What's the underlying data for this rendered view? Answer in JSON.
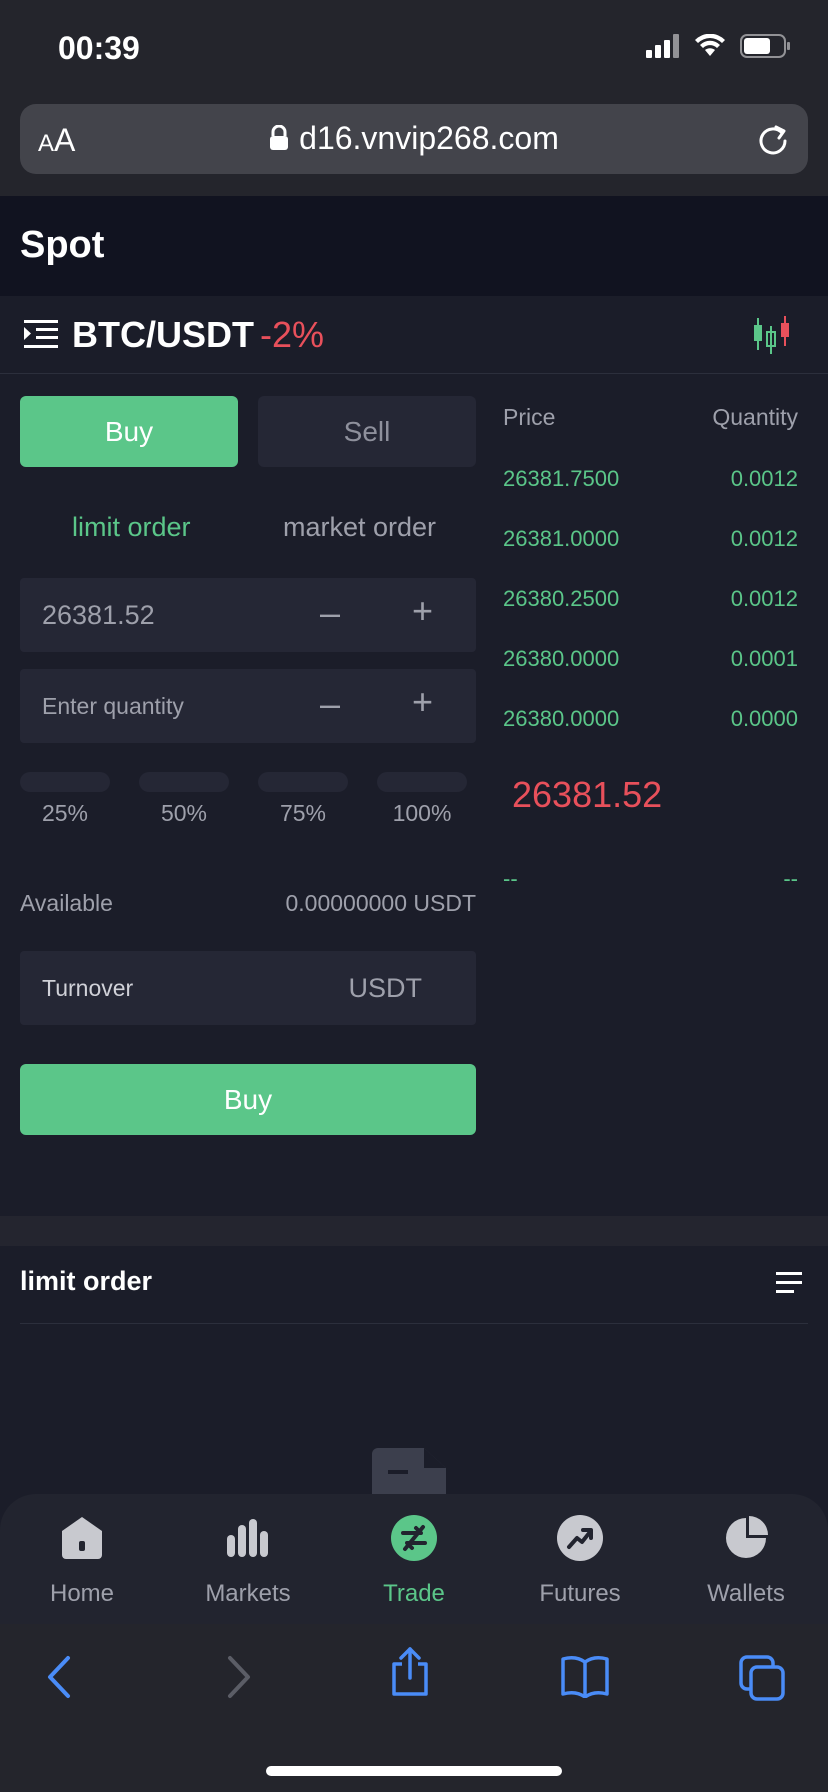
{
  "status_bar": {
    "time": "00:39"
  },
  "browser": {
    "text_size_label_small": "A",
    "text_size_label_large": "A",
    "url": "d16.vnvip268.com"
  },
  "page": {
    "title": "Spot"
  },
  "pair": {
    "name": "BTC/USDT",
    "change": "-2%"
  },
  "trade_form": {
    "tab_buy": "Buy",
    "tab_sell": "Sell",
    "order_type_limit": "limit order",
    "order_type_market": "market order",
    "price_value": "26381.52",
    "quantity_placeholder": "Enter quantity",
    "minus": "–",
    "plus": "+",
    "percents": [
      "25%",
      "50%",
      "75%",
      "100%"
    ],
    "available_label": "Available",
    "available_value": "0.00000000 USDT",
    "turnover_label": "Turnover",
    "turnover_unit": "USDT",
    "submit_label": "Buy"
  },
  "order_book": {
    "price_header": "Price",
    "quantity_header": "Quantity",
    "rows": [
      {
        "price": "26381.7500",
        "quantity": "0.0012"
      },
      {
        "price": "26381.0000",
        "quantity": "0.0012"
      },
      {
        "price": "26380.2500",
        "quantity": "0.0012"
      },
      {
        "price": "26380.0000",
        "quantity": "0.0001"
      },
      {
        "price": "26380.0000",
        "quantity": "0.0000"
      }
    ],
    "last_price": "26381.52",
    "bid_placeholder_price": "--",
    "bid_placeholder_qty": "--"
  },
  "orders": {
    "title": "limit order"
  },
  "bottom_nav": {
    "items": [
      {
        "label": "Home",
        "icon": "home-icon"
      },
      {
        "label": "Markets",
        "icon": "markets-icon"
      },
      {
        "label": "Trade",
        "icon": "trade-icon",
        "active": true
      },
      {
        "label": "Futures",
        "icon": "futures-icon"
      },
      {
        "label": "Wallets",
        "icon": "wallets-icon"
      }
    ]
  },
  "colors": {
    "buy": "#5bc689",
    "sell": "#e8505b",
    "background": "#1b1d29",
    "safari_blue": "#4a8cf7"
  }
}
